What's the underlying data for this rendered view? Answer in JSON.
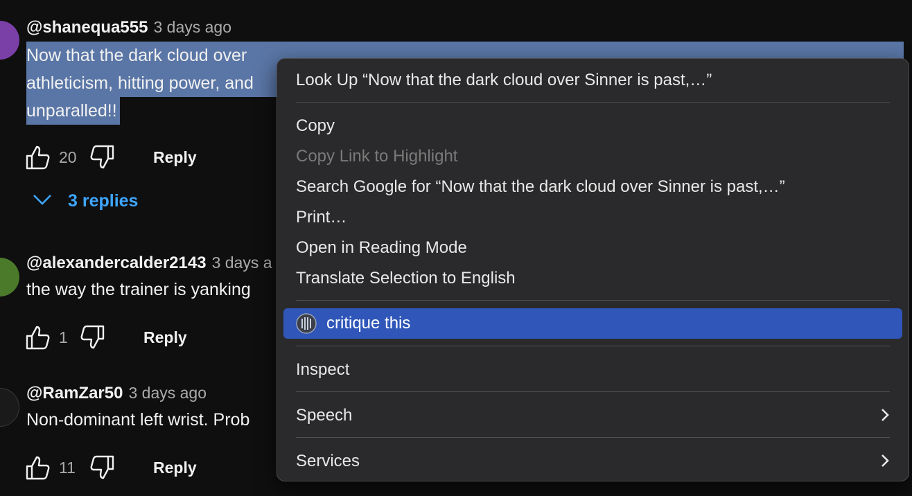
{
  "comments": [
    {
      "author": "@shanequa555",
      "time": "3 days ago",
      "lines": [
        "Now that the dark cloud over",
        "athleticism, hitting power, and",
        "unparalled!!"
      ],
      "likes": "20",
      "reply_label": "Reply",
      "avatar_color": "#7b3fa8"
    },
    {
      "author": "@alexandercalder2143",
      "time": "3 days a",
      "lines": [
        "the way the trainer is yanking"
      ],
      "likes": "1",
      "reply_label": "Reply",
      "avatar_color": "#4b7a2a"
    },
    {
      "author": "@RamZar50",
      "time": "3 days ago",
      "lines": [
        "Non-dominant left wrist. Prob"
      ],
      "likes": "11",
      "reply_label": "Reply",
      "avatar_color": "#1a1a1a"
    }
  ],
  "replies_toggle": "3 replies",
  "selection_color": "#5a76a6",
  "context_menu": {
    "items": [
      {
        "label": "Look Up “Now that the dark cloud over Sinner is past,…”"
      },
      {
        "label": "Copy"
      },
      {
        "label": "Copy Link to Highlight",
        "disabled": true
      },
      {
        "label": "Search Google for “Now that the dark cloud over Sinner is past,…”"
      },
      {
        "label": "Print…"
      },
      {
        "label": "Open in Reading Mode"
      },
      {
        "label": "Translate Selection to English"
      },
      {
        "label": "critique this",
        "highlighted": true
      },
      {
        "label": "Inspect"
      },
      {
        "label": "Speech",
        "submenu": true
      },
      {
        "label": "Services",
        "submenu": true
      }
    ],
    "highlight_color": "#2f56b8"
  }
}
